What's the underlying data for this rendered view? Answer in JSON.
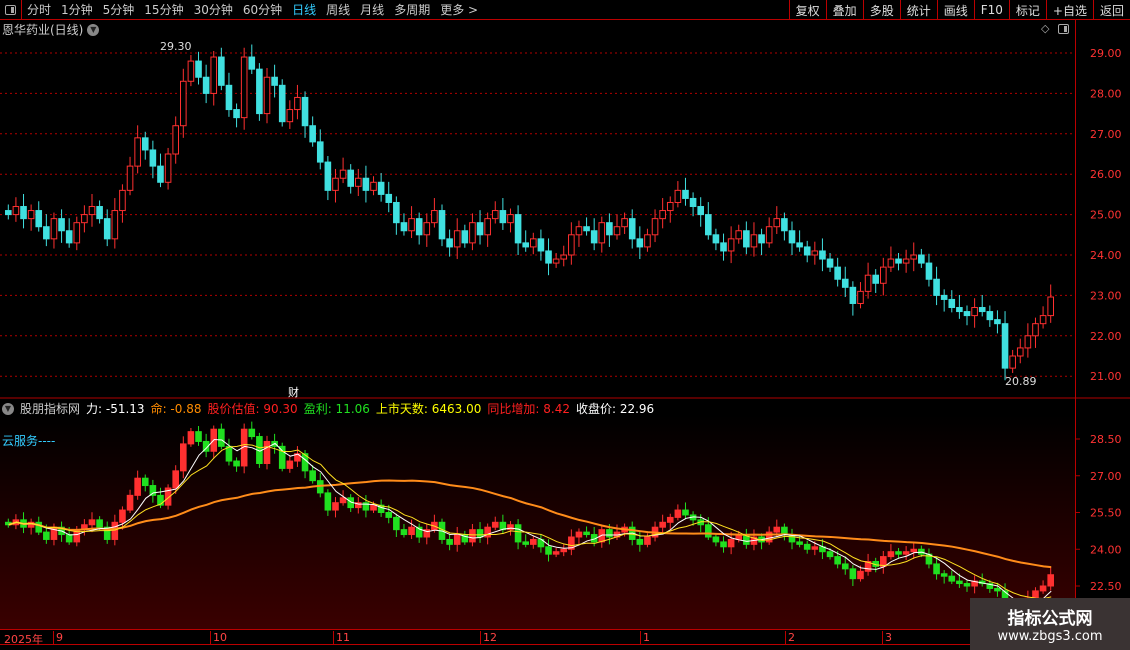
{
  "toolbar": {
    "tabs": [
      "分时",
      "1分钟",
      "5分钟",
      "15分钟",
      "30分钟",
      "60分钟",
      "日线",
      "周线",
      "月线",
      "多周期",
      "更多 >"
    ],
    "active": "日线",
    "right_buttons": [
      "复权",
      "叠加",
      "多股",
      "统计",
      "画线",
      "F10",
      "标记",
      "+自选",
      "返回"
    ]
  },
  "main": {
    "title": "恩华药业(日线)",
    "high_label": "29.30",
    "low_label": "20.89",
    "cai_label": "财",
    "price_ticks": [
      "29.00",
      "28.00",
      "27.00",
      "26.00",
      "25.00",
      "24.00",
      "23.00",
      "22.00",
      "21.00"
    ]
  },
  "indicator": {
    "name": "股朋指标网",
    "fields": [
      {
        "label": "力: -51.13",
        "color": "#ffffff"
      },
      {
        "label": "命: -0.88",
        "color": "#ff8c00"
      },
      {
        "label": "股价估值: 90.30",
        "color": "#ff2020"
      },
      {
        "label": "盈利: 11.06",
        "color": "#20e020"
      },
      {
        "label": "上市天数: 6463.00",
        "color": "#ffff00"
      },
      {
        "label": "同比增加: 8.42",
        "color": "#ff2020"
      },
      {
        "label": "收盘价: 22.96",
        "color": "#ffffff"
      }
    ],
    "cloud": "云服务----",
    "ticks": [
      "28.50",
      "27.00",
      "25.50",
      "24.00",
      "22.50"
    ]
  },
  "dates": [
    "2025年",
    "9",
    "10",
    "11",
    "12",
    "1",
    "2",
    "3"
  ],
  "watermark": {
    "name": "指标公式网",
    "url": "www.zbgs3.com"
  },
  "colors": {
    "up": "#ff3030",
    "down": "#40e0e0",
    "down_lower": "#20e020",
    "ma_slow": "#ff8c1a",
    "grid": "#b00000"
  },
  "chart_data": {
    "type": "candlestick",
    "closes": [
      25.0,
      25.2,
      24.9,
      25.1,
      24.7,
      24.4,
      24.9,
      24.6,
      24.3,
      24.8,
      25.0,
      25.2,
      24.9,
      24.4,
      25.1,
      25.6,
      26.2,
      26.9,
      26.6,
      26.2,
      25.8,
      26.5,
      27.2,
      28.3,
      28.8,
      28.4,
      28.0,
      28.9,
      28.2,
      27.6,
      27.4,
      28.9,
      28.6,
      27.5,
      28.4,
      28.2,
      27.3,
      27.6,
      27.9,
      27.2,
      26.8,
      26.3,
      25.6,
      25.9,
      26.1,
      25.7,
      25.9,
      25.6,
      25.8,
      25.5,
      25.3,
      24.8,
      24.6,
      24.9,
      24.5,
      24.8,
      25.1,
      24.4,
      24.2,
      24.6,
      24.3,
      24.8,
      24.5,
      24.9,
      25.1,
      24.8,
      25.0,
      24.3,
      24.2,
      24.4,
      24.1,
      23.8,
      23.9,
      24.0,
      24.5,
      24.7,
      24.6,
      24.3,
      24.8,
      24.5,
      24.7,
      24.9,
      24.4,
      24.2,
      24.5,
      24.9,
      25.1,
      25.3,
      25.6,
      25.4,
      25.2,
      25.0,
      24.5,
      24.3,
      24.1,
      24.4,
      24.6,
      24.2,
      24.5,
      24.3,
      24.7,
      24.9,
      24.6,
      24.3,
      24.2,
      24.0,
      24.1,
      23.9,
      23.7,
      23.4,
      23.2,
      22.8,
      23.1,
      23.5,
      23.3,
      23.7,
      23.9,
      23.8,
      23.9,
      24.0,
      23.8,
      23.4,
      23.0,
      22.9,
      22.7,
      22.6,
      22.5,
      22.7,
      22.6,
      22.4,
      22.3,
      21.2,
      21.5,
      21.7,
      22.0,
      22.3,
      22.5,
      22.96
    ]
  }
}
